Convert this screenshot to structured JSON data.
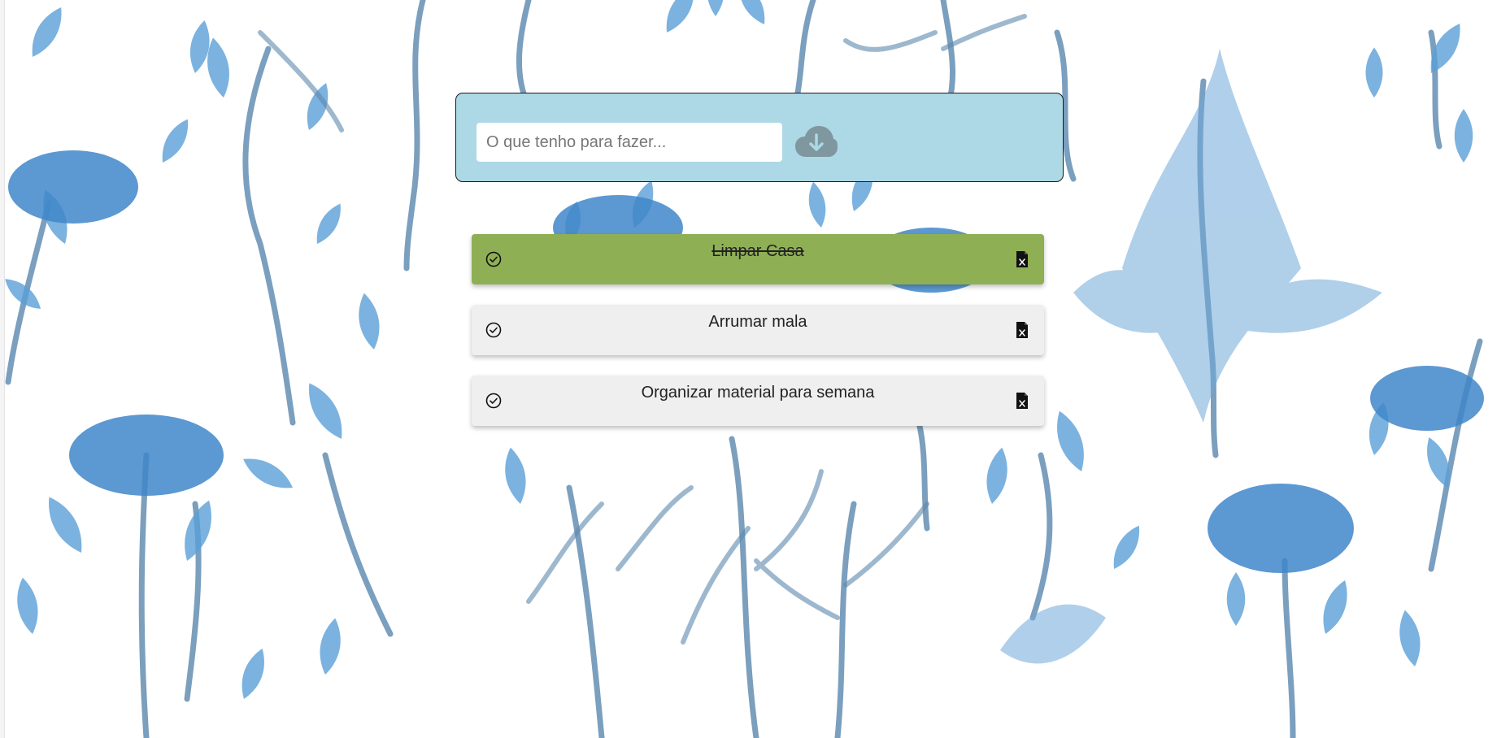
{
  "input": {
    "placeholder": "O que tenho para fazer...",
    "value": ""
  },
  "save_button": {
    "icon": "cloud-download-icon"
  },
  "tasks": [
    {
      "text": "Limpar Casa",
      "done": true
    },
    {
      "text": "Arrumar mala",
      "done": false
    },
    {
      "text": "Organizar material para semana",
      "done": false
    }
  ],
  "colors": {
    "panel": "#add8e6",
    "done_task": "#8faf55",
    "task": "#efefef",
    "cloud_icon": "#7f979e"
  }
}
